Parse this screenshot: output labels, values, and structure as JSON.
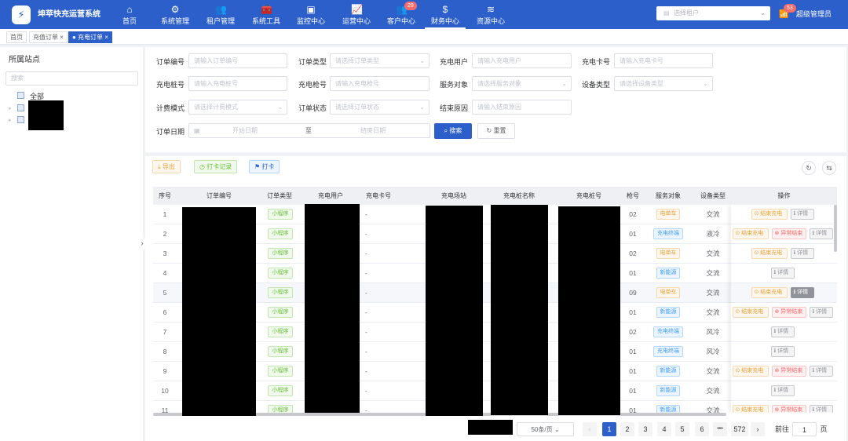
{
  "app": {
    "title": "坤苹快充运营系统",
    "logo_glyph": "⚡"
  },
  "nav": [
    {
      "label": "首页",
      "icon": "home-icon",
      "glyph": "⌂"
    },
    {
      "label": "系统管理",
      "icon": "gear-icon",
      "glyph": "⚙"
    },
    {
      "label": "租户管理",
      "icon": "users-icon",
      "glyph": "👥"
    },
    {
      "label": "系统工具",
      "icon": "toolbox-icon",
      "glyph": "🧰"
    },
    {
      "label": "监控中心",
      "icon": "monitor-icon",
      "glyph": "▣"
    },
    {
      "label": "运营中心",
      "icon": "chart-icon",
      "glyph": "📈"
    },
    {
      "label": "客户中心",
      "icon": "customer-icon",
      "glyph": "👥",
      "badge": "29"
    },
    {
      "label": "财务中心",
      "icon": "money-icon",
      "glyph": "$",
      "active": true
    },
    {
      "label": "资源中心",
      "icon": "layers-icon",
      "glyph": "≋"
    }
  ],
  "header": {
    "tenant_placeholder": "选择租户",
    "notify_badge": "53",
    "user": "超级管理员"
  },
  "tabs": [
    {
      "label": "首页"
    },
    {
      "label": "充值订单 ×"
    },
    {
      "label": "● 充电订单 ×",
      "active": true
    }
  ],
  "sidebar": {
    "title": "所属站点",
    "search_placeholder": "搜索",
    "root_label": "全部"
  },
  "filters": {
    "order_no": {
      "label": "订单编号",
      "placeholder": "请输入订单编号"
    },
    "order_type": {
      "label": "订单类型",
      "placeholder": "请选择订单类型"
    },
    "user": {
      "label": "充电用户",
      "placeholder": "请输入充电用户"
    },
    "card": {
      "label": "充电卡号",
      "placeholder": "请输入充电卡号"
    },
    "pile": {
      "label": "充电桩号",
      "placeholder": "请输入充电桩号"
    },
    "gun": {
      "label": "充电枪号",
      "placeholder": "请输入充电枪号"
    },
    "service": {
      "label": "服务对象",
      "placeholder": "请选择服务对象"
    },
    "device": {
      "label": "设备类型",
      "placeholder": "请选择设备类型"
    },
    "billing": {
      "label": "计费模式",
      "placeholder": "请选择计费模式"
    },
    "status": {
      "label": "订单状态",
      "placeholder": "请选择订单状态"
    },
    "reason": {
      "label": "结束原因",
      "placeholder": "请输入结束原因"
    },
    "date": {
      "label": "订单日期",
      "start": "开始日期",
      "sep": "至",
      "end": "结束日期"
    },
    "search_btn": "搜索",
    "reset_btn": "重置"
  },
  "toolbar": {
    "export": "导出",
    "checkin_log": "打卡记录",
    "checkin": "打卡"
  },
  "table": {
    "columns": [
      "序号",
      "订单编号",
      "订单类型",
      "充电用户",
      "充电卡号",
      "充电场站",
      "充电桩名称",
      "充电桩号",
      "枪号",
      "服务对象",
      "设备类型",
      "操作"
    ],
    "action_labels": {
      "end": "结束充电",
      "abnormal": "异常结束",
      "detail": "详情"
    },
    "rows": [
      {
        "no": "1",
        "type": "小程序",
        "card": "-",
        "gun": "02",
        "service": "电单车",
        "service_color": "orange",
        "device": "交流",
        "actions": [
          "end",
          "detail"
        ]
      },
      {
        "no": "2",
        "type": "小程序",
        "card": "-",
        "gun": "01",
        "service": "充电终端",
        "service_color": "blue",
        "device": "液冷",
        "actions": [
          "end",
          "abnormal",
          "detail"
        ]
      },
      {
        "no": "3",
        "type": "小程序",
        "card": "-",
        "gun": "02",
        "service": "电单车",
        "service_color": "orange",
        "device": "交流",
        "actions": [
          "end",
          "detail"
        ]
      },
      {
        "no": "4",
        "type": "小程序",
        "card": "-",
        "gun": "01",
        "service": "新能源",
        "service_color": "blue",
        "device": "交流",
        "actions": [
          "detail"
        ]
      },
      {
        "no": "5",
        "type": "小程序",
        "card": "-",
        "gun": "09",
        "service": "电单车",
        "service_color": "orange",
        "device": "交流",
        "actions": [
          "end",
          "detail"
        ],
        "highlight": true
      },
      {
        "no": "6",
        "type": "小程序",
        "card": "-",
        "gun": "01",
        "service": "新能源",
        "service_color": "blue",
        "device": "交流",
        "actions": [
          "end",
          "abnormal",
          "detail"
        ]
      },
      {
        "no": "7",
        "type": "小程序",
        "card": "-",
        "gun": "02",
        "service": "充电终端",
        "service_color": "blue",
        "device": "风冷",
        "actions": [
          "detail"
        ]
      },
      {
        "no": "8",
        "type": "小程序",
        "card": "-",
        "gun": "01",
        "service": "充电终端",
        "service_color": "blue",
        "device": "风冷",
        "actions": [
          "detail"
        ]
      },
      {
        "no": "9",
        "type": "小程序",
        "card": "-",
        "gun": "01",
        "service": "新能源",
        "service_color": "blue",
        "device": "交流",
        "actions": [
          "end",
          "abnormal",
          "detail"
        ]
      },
      {
        "no": "10",
        "type": "小程序",
        "card": "-",
        "gun": "01",
        "service": "新能源",
        "service_color": "blue",
        "device": "交流",
        "actions": [
          "detail"
        ]
      },
      {
        "no": "11",
        "type": "小程序",
        "card": "-",
        "gun": "01",
        "service": "新能源",
        "service_color": "blue",
        "device": "交流",
        "actions": [
          "end",
          "abnormal",
          "detail"
        ]
      }
    ]
  },
  "pagination": {
    "page_size": "50条/页",
    "pages": [
      "1",
      "2",
      "3",
      "4",
      "5",
      "6"
    ],
    "current": "1",
    "ellipsis": "•••",
    "last": "572",
    "goto_label": "前往",
    "goto_value": "1",
    "page_unit": "页"
  },
  "colors": {
    "primary": "#2d5fcb",
    "header_bg": "#2d5fcb",
    "danger": "#f56c6c",
    "warning": "#e6a23c",
    "success": "#67c23a"
  }
}
